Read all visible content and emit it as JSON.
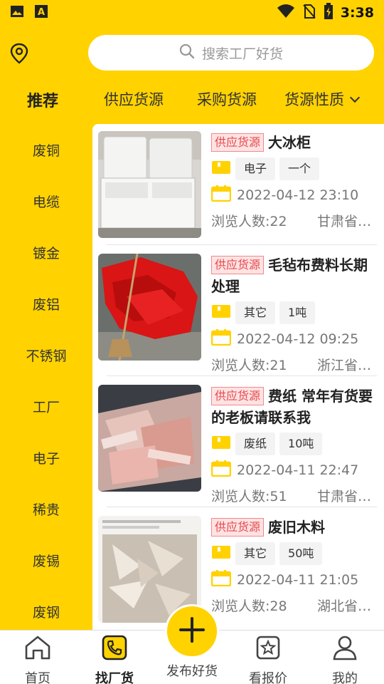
{
  "status_bar": {
    "time": "3:38"
  },
  "header": {
    "search_placeholder": "搜索工厂好货"
  },
  "tabs": [
    {
      "label": "推荐"
    },
    {
      "label": "供应货源"
    },
    {
      "label": "采购货源"
    },
    {
      "label": "货源性质"
    }
  ],
  "sidebar": {
    "items": [
      {
        "label": "废铜"
      },
      {
        "label": "电缆"
      },
      {
        "label": "镀金"
      },
      {
        "label": "废铝"
      },
      {
        "label": "不锈钢"
      },
      {
        "label": "工厂"
      },
      {
        "label": "电子"
      },
      {
        "label": "稀贵"
      },
      {
        "label": "废锡"
      },
      {
        "label": "废钢"
      }
    ]
  },
  "listings": [
    {
      "tag": "供应货源",
      "title": "大冰柜",
      "category": "电子",
      "quantity": "一个",
      "date": "2022-04-12 23:10",
      "views": "浏览人数:22",
      "region": "甘肃省…"
    },
    {
      "tag": "供应货源",
      "title": "毛毡布费料长期处理",
      "category": "其它",
      "quantity": "1吨",
      "date": "2022-04-12 09:25",
      "views": "浏览人数:21",
      "region": "浙江省…"
    },
    {
      "tag": "供应货源",
      "title": "费纸 常年有货要的老板请联系我",
      "category": "废纸",
      "quantity": "10吨",
      "date": "2022-04-11 22:47",
      "views": "浏览人数:51",
      "region": "甘肃省…"
    },
    {
      "tag": "供应货源",
      "title": "废旧木料",
      "category": "其它",
      "quantity": "50吨",
      "date": "2022-04-11 21:05",
      "views": "浏览人数:28",
      "region": "湖北省…"
    }
  ],
  "bottom_nav": {
    "items": [
      {
        "label": "首页",
        "icon": "home-icon"
      },
      {
        "label": "找厂货",
        "icon": "phone-icon"
      },
      {
        "label": "看报价",
        "icon": "star-box-icon"
      },
      {
        "label": "我的",
        "icon": "user-icon"
      }
    ],
    "publish_label": "发布好货"
  },
  "colors": {
    "brand": "#FFD200",
    "tag_red": "#E5484D",
    "text_gray": "#777777"
  }
}
